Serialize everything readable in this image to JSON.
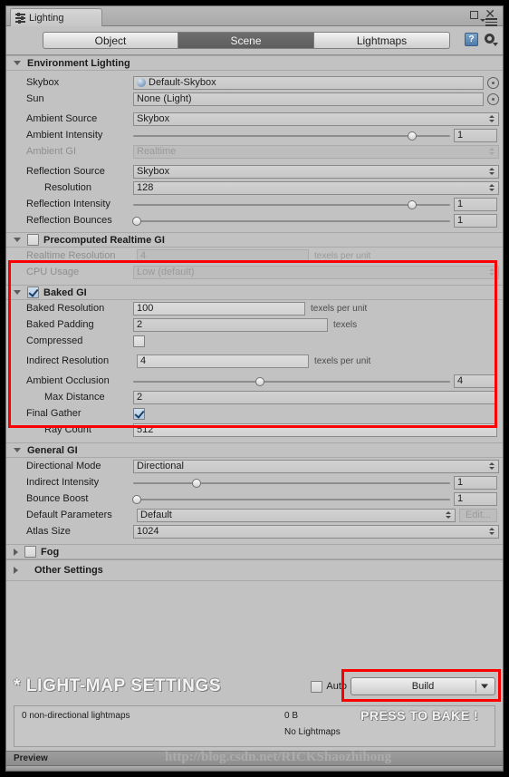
{
  "window": {
    "tab_title": "Lighting",
    "tab_icon": "lighting-settings-icon",
    "minimize_icon": "maximize-icon",
    "close_icon": "close-icon",
    "menu_icon": "panel-menu-icon"
  },
  "toolbar": {
    "tabs": [
      {
        "label": "Object",
        "active": false
      },
      {
        "label": "Scene",
        "active": true
      },
      {
        "label": "Lightmaps",
        "active": false
      }
    ],
    "help_icon": "help-icon",
    "help_glyph": "?",
    "gear_icon": "gear-icon"
  },
  "environment_lighting": {
    "title": "Environment Lighting",
    "skybox": {
      "label": "Skybox",
      "value": "Default-Skybox",
      "picker_icon": "object-picker-icon"
    },
    "sun": {
      "label": "Sun",
      "value": "None (Light)",
      "picker_icon": "object-picker-icon"
    },
    "ambient_source": {
      "label": "Ambient Source",
      "value": "Skybox"
    },
    "ambient_intensity": {
      "label": "Ambient Intensity",
      "value": "1",
      "slider_pct": 88
    },
    "ambient_gi": {
      "label": "Ambient GI",
      "value": "Realtime",
      "disabled": true
    },
    "reflection_source": {
      "label": "Reflection Source",
      "value": "Skybox"
    },
    "resolution": {
      "label": "Resolution",
      "value": "128"
    },
    "reflection_intensity": {
      "label": "Reflection Intensity",
      "value": "1",
      "slider_pct": 88
    },
    "reflection_bounces": {
      "label": "Reflection Bounces",
      "value": "1",
      "slider_pct": 1
    }
  },
  "precomputed_realtime_gi": {
    "title": "Precomputed Realtime GI",
    "checked": false,
    "realtime_resolution": {
      "label": "Realtime Resolution",
      "value": "4",
      "unit": "texels per unit"
    },
    "cpu_usage": {
      "label": "CPU Usage",
      "value": "Low (default)"
    }
  },
  "baked_gi": {
    "title": "Baked GI",
    "checked": true,
    "baked_resolution": {
      "label": "Baked Resolution",
      "value": "100",
      "unit": "texels per unit"
    },
    "baked_padding": {
      "label": "Baked Padding",
      "value": "2",
      "unit": "texels"
    },
    "compressed": {
      "label": "Compressed",
      "checked": false
    },
    "indirect_resolution": {
      "label": "Indirect Resolution",
      "value": "4",
      "unit": "texels per unit"
    },
    "ambient_occlusion": {
      "label": "Ambient Occlusion",
      "value": "4",
      "slider_pct": 40
    },
    "max_distance": {
      "label": "Max Distance",
      "value": "2"
    },
    "final_gather": {
      "label": "Final Gather",
      "checked": true
    },
    "ray_count": {
      "label": "Ray Count",
      "value": "512"
    }
  },
  "general_gi": {
    "title": "General GI",
    "directional_mode": {
      "label": "Directional Mode",
      "value": "Directional"
    },
    "indirect_intensity": {
      "label": "Indirect Intensity",
      "value": "1",
      "slider_pct": 20
    },
    "bounce_boost": {
      "label": "Bounce Boost",
      "value": "1",
      "slider_pct": 1
    },
    "default_parameters": {
      "label": "Default Parameters",
      "value": "Default",
      "edit_label": "Edit..."
    },
    "atlas_size": {
      "label": "Atlas Size",
      "value": "1024"
    }
  },
  "fog": {
    "title": "Fog",
    "checked": false
  },
  "other_settings": {
    "title": "Other Settings"
  },
  "bottom": {
    "annotation_title": "* LIGHT-MAP SETTINGS",
    "auto_label": "Auto",
    "auto_checked": false,
    "build_label": "Build",
    "build_dropdown_icon": "chevron-down-icon",
    "annotation_bake": "PRESS TO BAKE !",
    "stat_lightmaps": "0 non-directional lightmaps",
    "stat_size": "0 B",
    "stat_status": "No Lightmaps",
    "preview_label": "Preview",
    "watermark": "http://blog.csdn.net/RICKShaozhihong"
  },
  "highlight_color": "#fa0000"
}
